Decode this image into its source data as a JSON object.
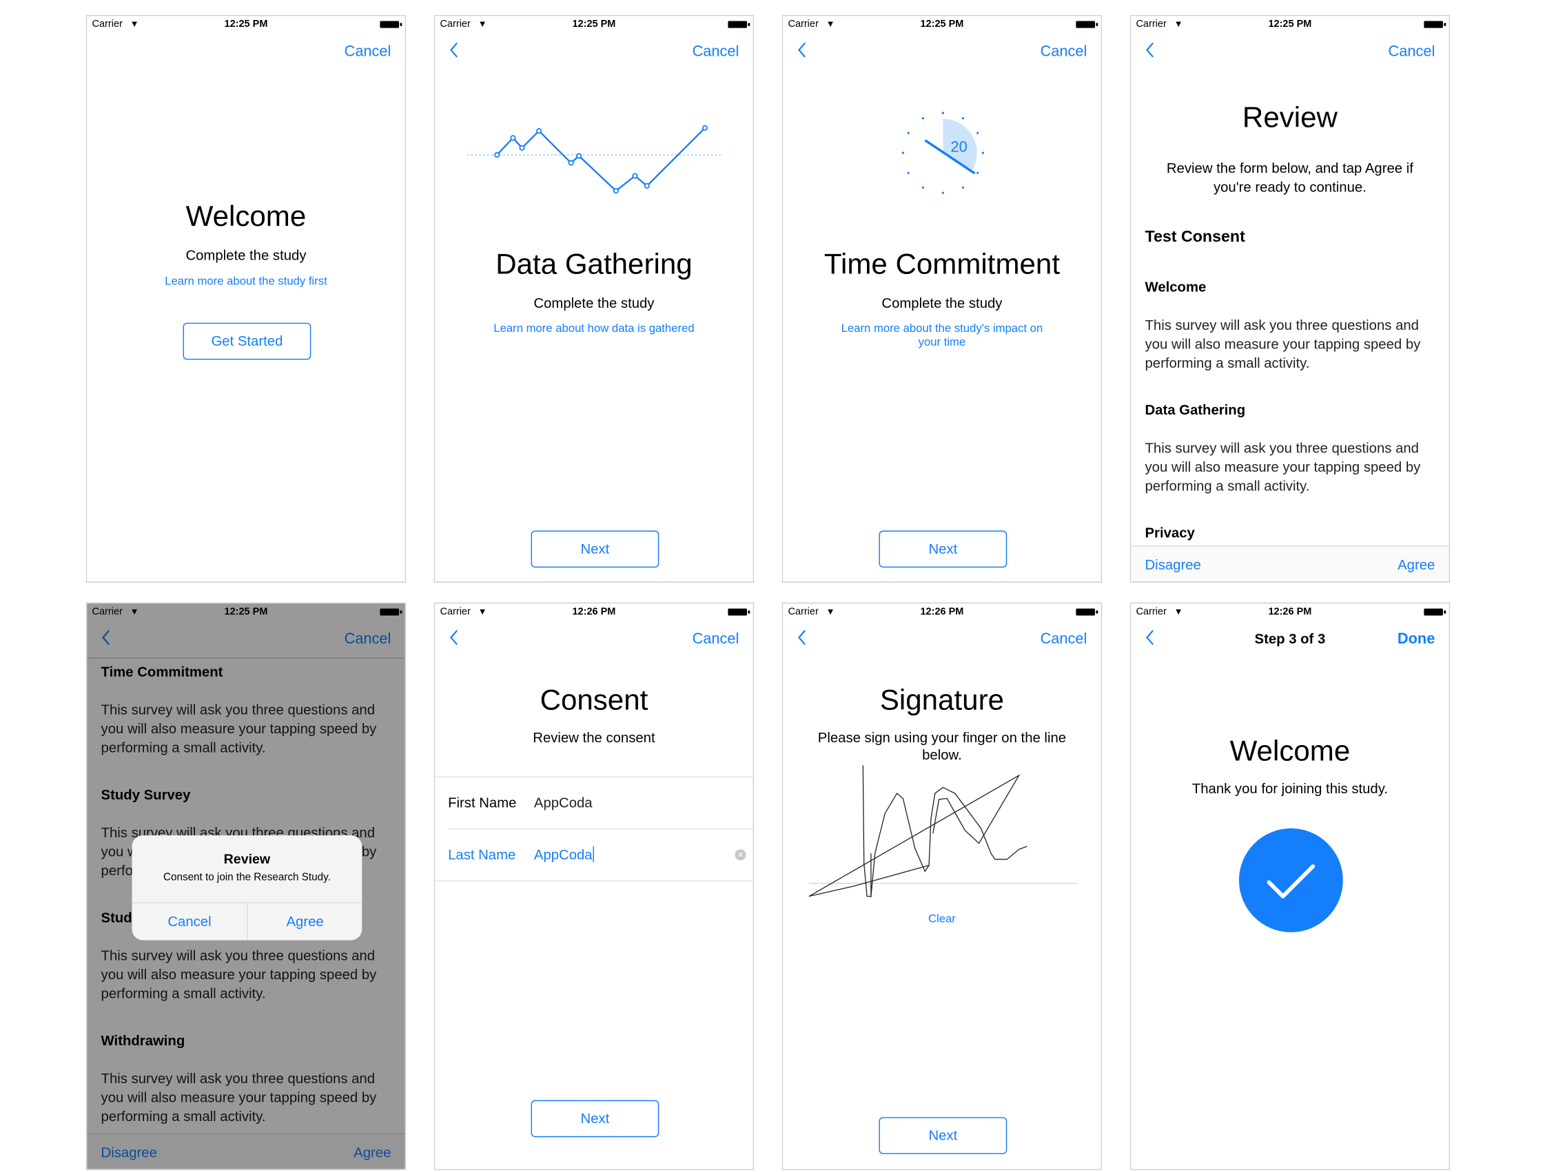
{
  "status_bars": [
    {
      "carrier": "Carrier",
      "time": "12:25 PM"
    },
    {
      "carrier": "Carrier",
      "time": "12:25 PM"
    },
    {
      "carrier": "Carrier",
      "time": "12:25 PM"
    },
    {
      "carrier": "Carrier",
      "time": "12:25 PM"
    },
    {
      "carrier": "Carrier",
      "time": "12:25 PM"
    },
    {
      "carrier": "Carrier",
      "time": "12:26 PM"
    },
    {
      "carrier": "Carrier",
      "time": "12:26 PM"
    },
    {
      "carrier": "Carrier",
      "time": "12:26 PM"
    }
  ],
  "accent_color": "#147efb",
  "cancel_label": "Cancel",
  "welcome": {
    "title": "Welcome",
    "subtitle": "Complete the study",
    "link": "Learn more about the study first",
    "button": "Get Started"
  },
  "data_gathering": {
    "title": "Data Gathering",
    "subtitle": "Complete the study",
    "link": "Learn more about how data is gathered",
    "button": "Next"
  },
  "time_commitment": {
    "title": "Time Commitment",
    "subtitle": "Complete the study",
    "link_line1": "Learn more about the study's impact on",
    "link_line2": "your time",
    "clock_value": "20",
    "button": "Next"
  },
  "review": {
    "title": "Review",
    "instructions_line1": "Review the form below, and tap Agree if",
    "instructions_line2": "you're ready to continue.",
    "document_title": "Test Consent",
    "sections": [
      {
        "heading": "Welcome",
        "body": "This survey will ask you three questions and you will also measure your tapping speed by performing a small activity."
      },
      {
        "heading": "Data Gathering",
        "body": "This survey will ask you three questions and you will also measure your tapping speed by performing a small activity."
      },
      {
        "heading": "Privacy"
      }
    ],
    "disagree": "Disagree",
    "agree": "Agree"
  },
  "review_alert_screen": {
    "sections": [
      {
        "heading": "Time Commitment",
        "body": "This survey will ask you three questions and you will also measure your tapping speed by performing a small activity."
      },
      {
        "heading": "Study Survey",
        "body": "This survey will ask you three questions and you will also measure your tapping speed by performing a small activity."
      },
      {
        "heading": "Study Tasks",
        "body": "This survey will ask you three questions and you will also measure your tapping speed by performing a small activity."
      },
      {
        "heading": "Withdrawing",
        "body": "This survey will ask you three questions and you will also measure your tapping speed by performing a small activity."
      }
    ],
    "disagree": "Disagree",
    "agree": "Agree",
    "alert": {
      "title": "Review",
      "message": "Consent to join the Research Study.",
      "cancel": "Cancel",
      "agree": "Agree"
    }
  },
  "consent": {
    "title": "Consent",
    "subtitle": "Review the consent",
    "first_name_label": "First Name",
    "first_name_value": "AppCoda",
    "last_name_label": "Last Name",
    "last_name_value": "AppCoda",
    "button": "Next"
  },
  "signature": {
    "title": "Signature",
    "instructions_line1": "Please sign using your finger on the line",
    "instructions_line2": "below.",
    "clear": "Clear",
    "button": "Next"
  },
  "completion": {
    "nav_title": "Step 3 of 3",
    "done": "Done",
    "title": "Welcome",
    "message": "Thank you for joining this study.",
    "icon": "checkmark-circle-icon"
  }
}
